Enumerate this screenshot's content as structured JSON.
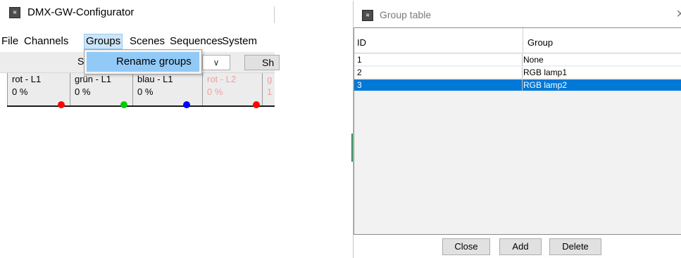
{
  "main_window": {
    "title": "DMX-GW-Configurator",
    "app_icon": "dmx-app-icon",
    "menu": [
      "File",
      "Channels",
      "Groups",
      "Scenes",
      "Sequences",
      "System"
    ],
    "toolbar": {
      "left_fragment": "S",
      "right_fragment": "Sh",
      "combo_icon": "chevron-down-icon"
    },
    "channels": [
      {
        "name": "rot - L1",
        "value": "0 %",
        "color": "#ff0000",
        "disabled": false
      },
      {
        "name": "grün - L1",
        "value": "0 %",
        "color": "#00cc00",
        "disabled": false
      },
      {
        "name": "blau - L1",
        "value": "0 %",
        "color": "#0000ff",
        "disabled": false
      },
      {
        "name": "rot - L2",
        "value": "0 %",
        "color": "#ff0000",
        "disabled": true
      },
      {
        "name": "g",
        "value": "1",
        "color": "#ff0000",
        "disabled": true
      }
    ],
    "groups_menu": {
      "items": [
        "Rename groups"
      ]
    }
  },
  "dialog": {
    "title": "Group table",
    "columns": [
      "ID",
      "Group"
    ],
    "rows": [
      {
        "id": "1",
        "group": "None",
        "selected": false
      },
      {
        "id": "2",
        "group": "RGB lamp1",
        "selected": false
      },
      {
        "id": "3",
        "group": "RGB lamp2",
        "selected": true
      }
    ],
    "buttons": [
      "Close",
      "Add",
      "Delete"
    ],
    "selection_color": "#0078d7"
  }
}
